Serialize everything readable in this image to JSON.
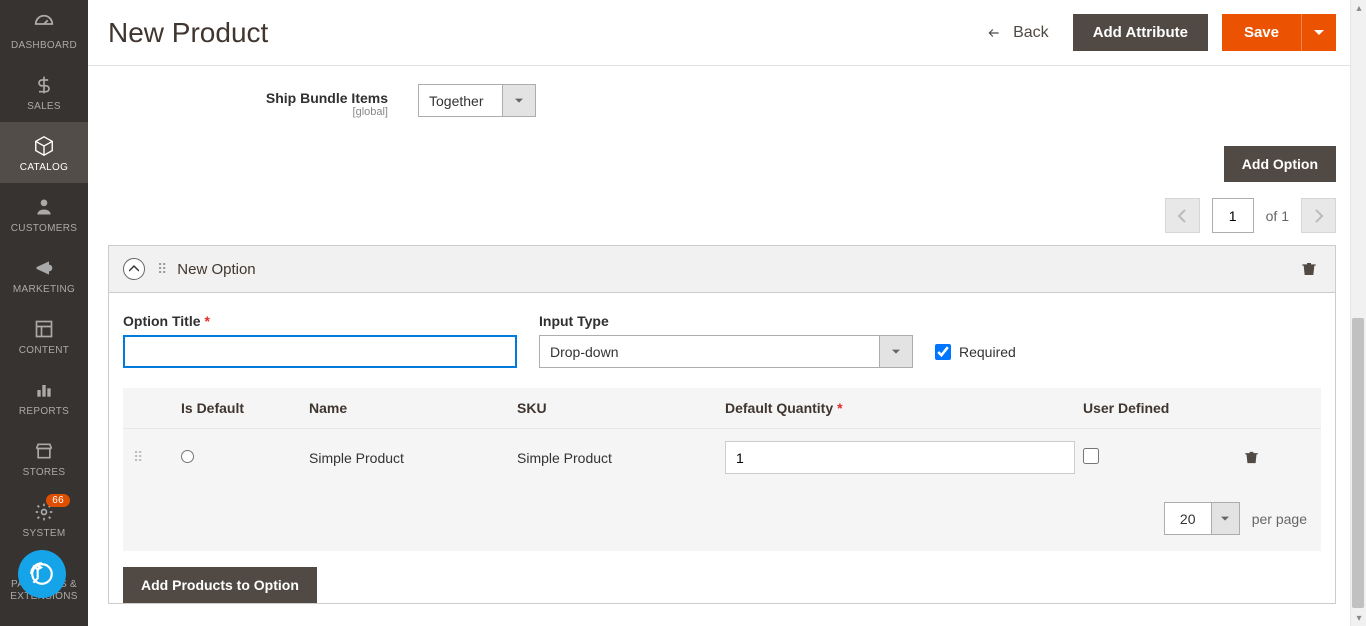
{
  "sidebar": {
    "items": [
      {
        "label": "DASHBOARD",
        "name": "sidebar-item-dashboard"
      },
      {
        "label": "SALES",
        "name": "sidebar-item-sales"
      },
      {
        "label": "CATALOG",
        "name": "sidebar-item-catalog",
        "active": true
      },
      {
        "label": "CUSTOMERS",
        "name": "sidebar-item-customers"
      },
      {
        "label": "MARKETING",
        "name": "sidebar-item-marketing"
      },
      {
        "label": "CONTENT",
        "name": "sidebar-item-content"
      },
      {
        "label": "REPORTS",
        "name": "sidebar-item-reports"
      },
      {
        "label": "STORES",
        "name": "sidebar-item-stores"
      },
      {
        "label": "SYSTEM",
        "name": "sidebar-item-system"
      },
      {
        "label": "FIND PARTNERS & EXTENSIONS",
        "name": "sidebar-item-partners"
      }
    ],
    "badge": "66"
  },
  "header": {
    "title": "New Product",
    "back": "Back",
    "add_attribute": "Add Attribute",
    "save": "Save"
  },
  "ship": {
    "label": "Ship Bundle Items",
    "scope": "[global]",
    "value": "Together"
  },
  "add_option_btn": "Add Option",
  "pager": {
    "page": "1",
    "of": "of 1"
  },
  "option": {
    "heading": "New Option",
    "title_label": "Option Title",
    "title_value": "",
    "input_type_label": "Input Type",
    "input_type_value": "Drop-down",
    "required_label": "Required"
  },
  "grid": {
    "headers": {
      "is_default": "Is Default",
      "name": "Name",
      "sku": "SKU",
      "default_qty": "Default Quantity",
      "user_defined": "User Defined"
    },
    "rows": [
      {
        "name": "Simple Product",
        "sku": "Simple Product",
        "qty": "1"
      }
    ],
    "per_page_value": "20",
    "per_page_label": "per page"
  },
  "add_products_btn": "Add Products to Option"
}
